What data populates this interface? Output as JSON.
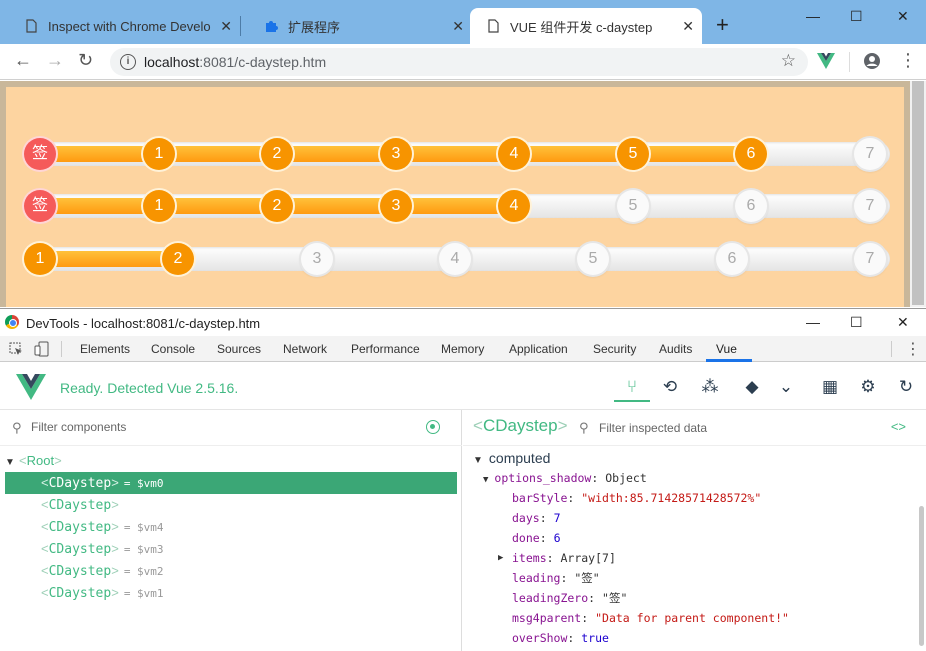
{
  "browser": {
    "tabs": [
      {
        "label": "Inspect with Chrome Develo",
        "icon": "document-icon"
      },
      {
        "label": "扩展程序",
        "icon": "puzzle-icon"
      },
      {
        "label": "VUE 组件开发 c-daystep",
        "icon": "document-icon"
      }
    ],
    "url_host": "localhost",
    "url_rest": ":8081/c-daystep.htm"
  },
  "daysteps": [
    {
      "leading": "签",
      "done_labels": [
        "1",
        "2",
        "3",
        "4",
        "5",
        "6"
      ],
      "todo_labels": [
        "7"
      ],
      "progress": 0.857
    },
    {
      "leading": "签",
      "done_labels": [
        "1",
        "2",
        "3",
        "4"
      ],
      "todo_labels": [
        "5",
        "6",
        "7"
      ],
      "progress": 0.571
    },
    {
      "leading": "",
      "done_labels": [
        "1",
        "2"
      ],
      "todo_labels": [
        "3",
        "4",
        "5",
        "6",
        "7"
      ],
      "progress": 0.167
    }
  ],
  "devtools": {
    "title": "DevTools - localhost:8081/c-daystep.htm",
    "tabs": [
      "Elements",
      "Console",
      "Sources",
      "Network",
      "Performance",
      "Memory",
      "Application",
      "Security",
      "Audits",
      "Vue"
    ],
    "active_tab": "Vue"
  },
  "vue": {
    "status": "Ready. Detected Vue 2.5.16.",
    "filter_components": "Filter components",
    "filter_data": "Filter inspected data",
    "tree": {
      "root": "Root",
      "items": [
        {
          "name": "CDaystep",
          "vm": "= $vm0"
        },
        {
          "name": "CDaystep",
          "vm": ""
        },
        {
          "name": "CDaystep",
          "vm": "= $vm4"
        },
        {
          "name": "CDaystep",
          "vm": "= $vm3"
        },
        {
          "name": "CDaystep",
          "vm": "= $vm2"
        },
        {
          "name": "CDaystep",
          "vm": "= $vm1"
        }
      ]
    },
    "inspected": "CDaystep",
    "section": "computed",
    "options_shadow": {
      "key": "options_shadow",
      "type": "Object",
      "props": [
        {
          "k": "barStyle",
          "v": "\"width:85.71428571428572%\"",
          "t": "s"
        },
        {
          "k": "days",
          "v": "7",
          "t": "n"
        },
        {
          "k": "done",
          "v": "6",
          "t": "n"
        },
        {
          "k": "items",
          "v": "Array[7]",
          "t": "p"
        },
        {
          "k": "leading",
          "v": "\"签\"",
          "t": "p"
        },
        {
          "k": "leadingZero",
          "v": "\"签\"",
          "t": "p"
        },
        {
          "k": "msg4parent",
          "v": "\"Data for parent component!\"",
          "t": "s"
        },
        {
          "k": "overShow",
          "v": "true",
          "t": "b"
        }
      ]
    }
  }
}
